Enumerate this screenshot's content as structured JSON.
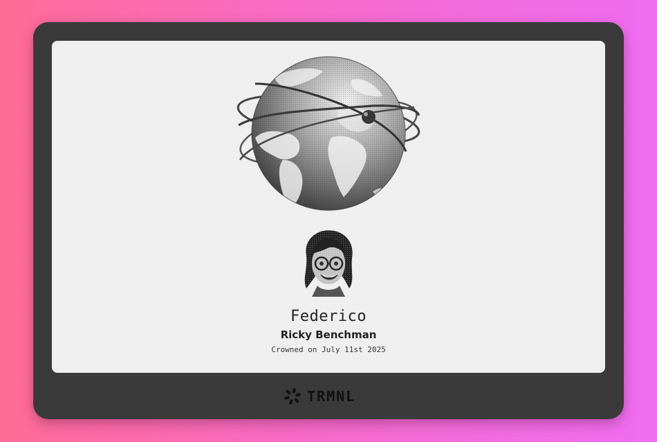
{
  "card": {
    "name": "Federico",
    "title": "Ricky Benchman",
    "crowned": "Crowned on July 11st 2025"
  },
  "device": {
    "brand": "TRMNL"
  },
  "icons": {
    "globe": "globe-with-orbits-icon",
    "avatar": "memoji-avatar-icon",
    "logo": "trmnl-logo-icon"
  },
  "colors": {
    "background_left": "#ff6b96",
    "background_right": "#f06cf2",
    "device_bezel": "#3a3a3a",
    "screen": "#efefef",
    "ink": "#222222"
  }
}
